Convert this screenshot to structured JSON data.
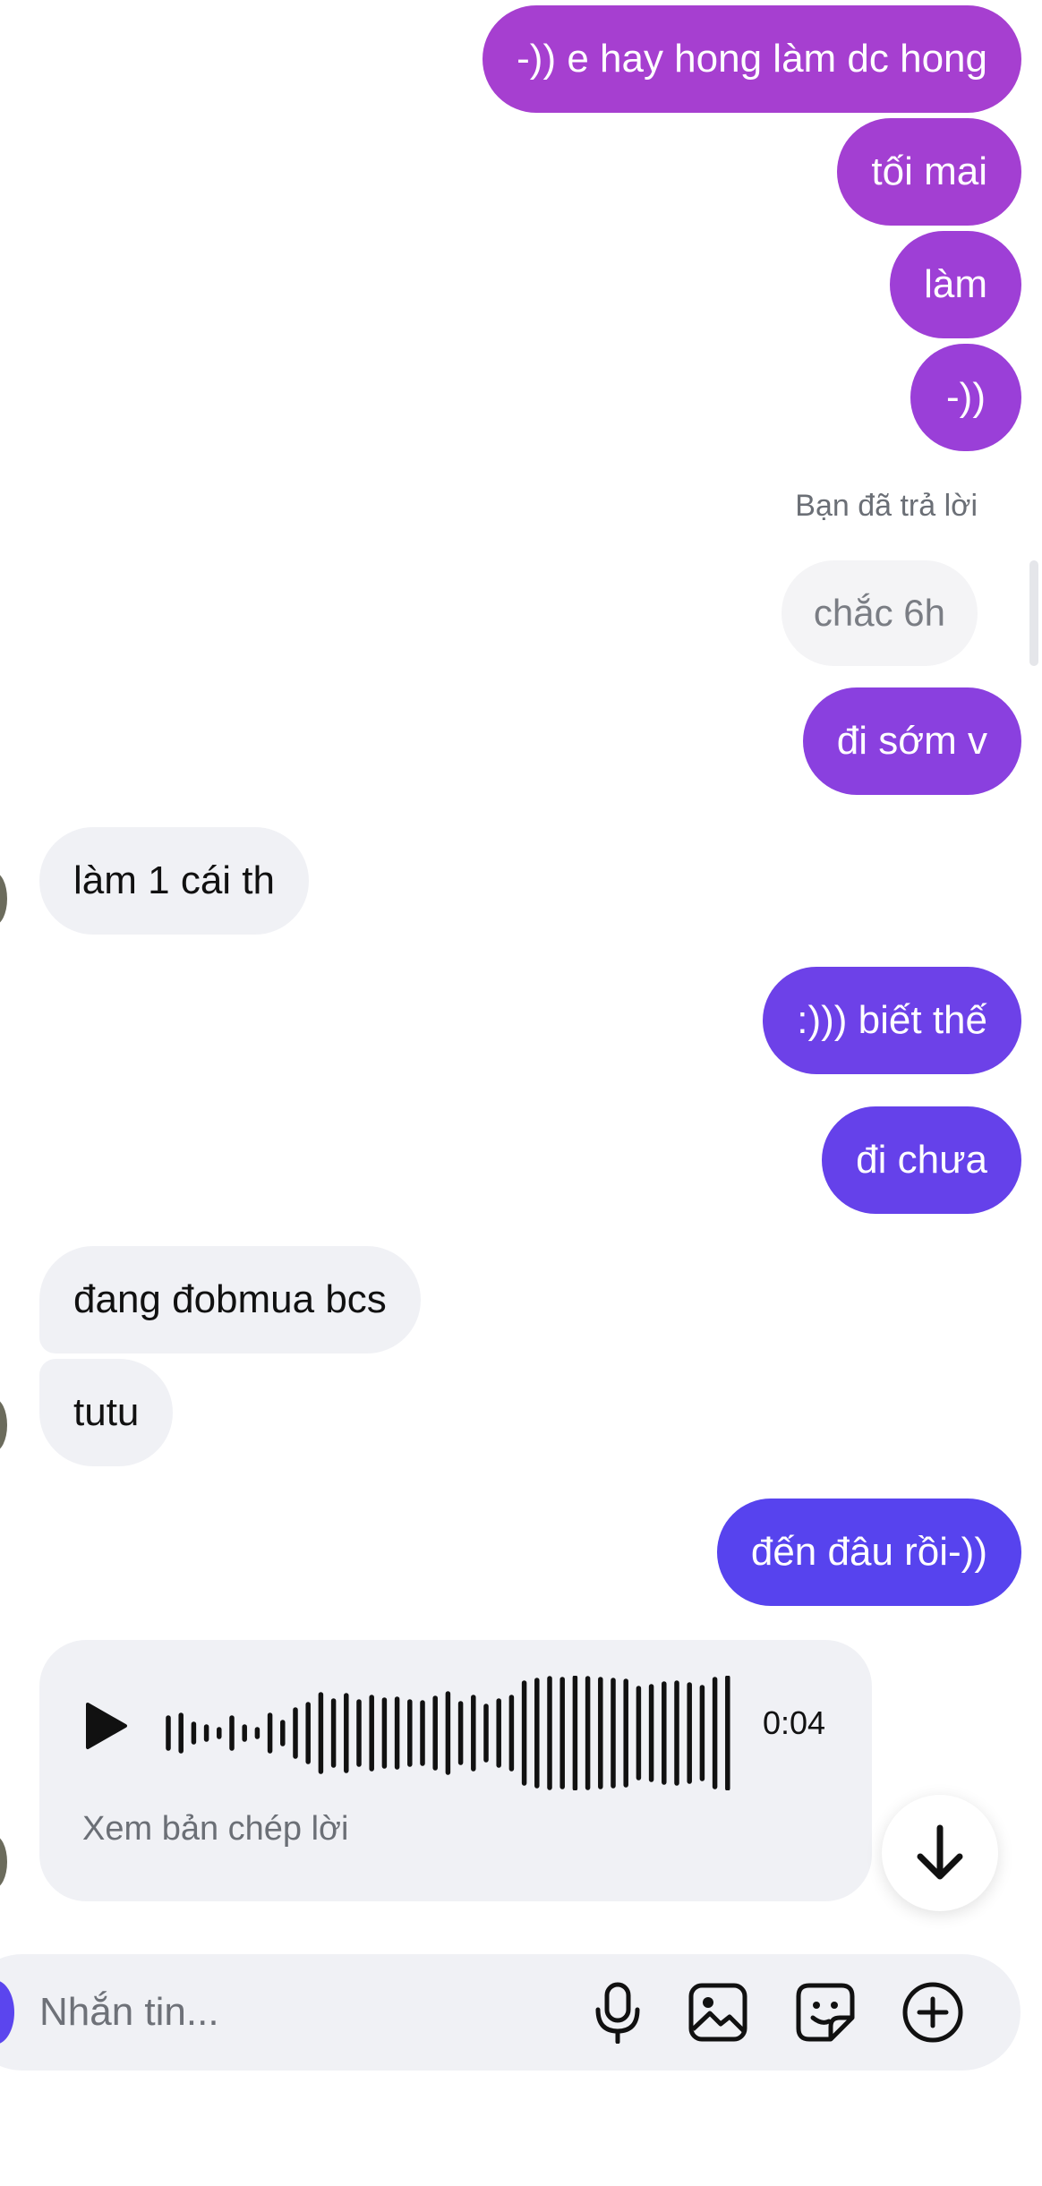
{
  "messages": {
    "m1": "-)) e hay hong làm dc hong",
    "m2": "tối mai",
    "m3": "làm",
    "m4": "-))",
    "reply_label": "Bạn đã trả lời",
    "reply_quote": "chắc 6h",
    "m5": "đi sớm v",
    "m6": "làm 1 cái th",
    "m7": ":))) biết thế",
    "m8": "đi chưa",
    "m9": "đang đobmua bcs",
    "m10": "tutu",
    "m11": "đến đâu rồi-))"
  },
  "voice_message": {
    "duration": "0:04",
    "transcript_link": "Xem bản chép lời"
  },
  "composer": {
    "placeholder": "Nhắn tin..."
  },
  "icons": {
    "play": "play-icon",
    "scroll_down": "arrow-down-icon",
    "mic": "microphone-icon",
    "gallery": "image-icon",
    "sticker": "sticker-icon",
    "add": "plus-circle-icon"
  },
  "colors": {
    "bubble_gradient_top": "#a63fd0",
    "bubble_gradient_bottom": "#5542ef",
    "incoming_bubble": "#f0f1f5"
  }
}
